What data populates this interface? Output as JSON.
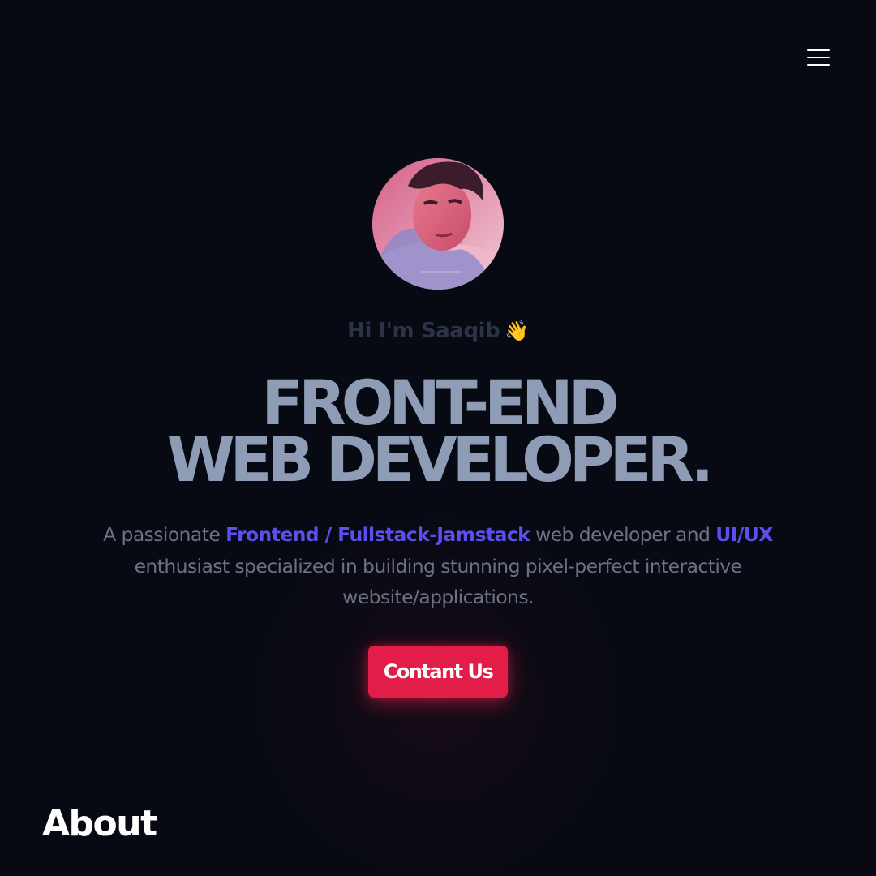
{
  "header": {
    "menu_icon": "hamburger-menu-icon"
  },
  "hero": {
    "avatar_icon": "profile-photo",
    "greeting": "Hi I'm Saaqib",
    "greeting_emoji": "👋",
    "headline_line1": "FRONT-END",
    "headline_line2": "WEB DEVELOPER.",
    "description": {
      "part1": "A passionate ",
      "highlight1": "Frontend / Fullstack-Jamstack",
      "part2": " web developer and ",
      "highlight2": "UI/UX",
      "part3": " enthusiast specialized in building stunning pixel-perfect interactive website/applications."
    },
    "cta_label": "Contant Us"
  },
  "about": {
    "title": "About"
  },
  "colors": {
    "background": "#080a13",
    "accent": "#5b50ef",
    "cta": "#e11d48",
    "headline": "#8e9cb5"
  }
}
